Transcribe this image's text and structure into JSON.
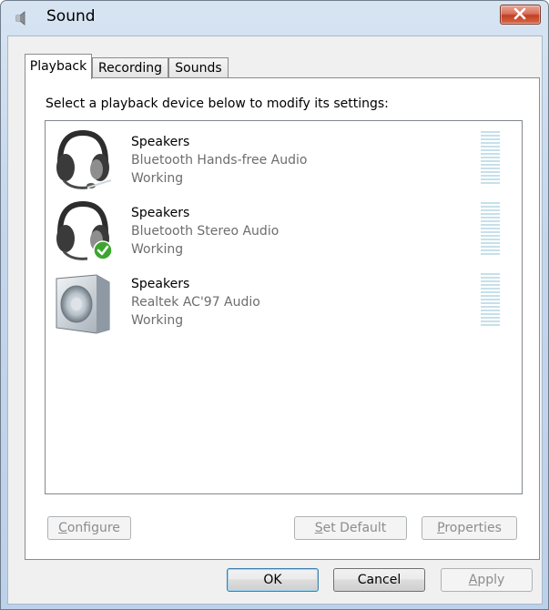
{
  "window": {
    "title": "Sound",
    "title_icon": "speaker-icon",
    "close_icon": "close-icon"
  },
  "tabs": [
    {
      "label": "Playback",
      "active": true
    },
    {
      "label": "Recording",
      "active": false
    },
    {
      "label": "Sounds",
      "active": false
    }
  ],
  "playback": {
    "instruction": "Select a playback device below to modify its settings:",
    "devices": [
      {
        "name": "Speakers",
        "description": "Bluetooth Hands-free Audio",
        "status": "Working",
        "icon": "headset-icon",
        "default": false
      },
      {
        "name": "Speakers",
        "description": "Bluetooth Stereo Audio",
        "status": "Working",
        "icon": "headset-icon",
        "default": true
      },
      {
        "name": "Speakers",
        "description": "Realtek AC'97 Audio",
        "status": "Working",
        "icon": "speaker-box-icon",
        "default": false
      }
    ]
  },
  "panel_buttons": {
    "configure": {
      "label_first": "C",
      "label_rest": "onfigure",
      "enabled": false
    },
    "set_default": {
      "label_first": "S",
      "label_rest": "et Default",
      "enabled": false
    },
    "properties": {
      "label_first": "P",
      "label_rest": "roperties",
      "enabled": false
    }
  },
  "dialog_buttons": {
    "ok": "OK",
    "cancel": "Cancel",
    "apply_first": "A",
    "apply_rest": "pply"
  },
  "colors": {
    "accent": "#3c7fb1",
    "close": "#c23f22",
    "meter": "#c6e0ea",
    "check": "#3da52f"
  }
}
